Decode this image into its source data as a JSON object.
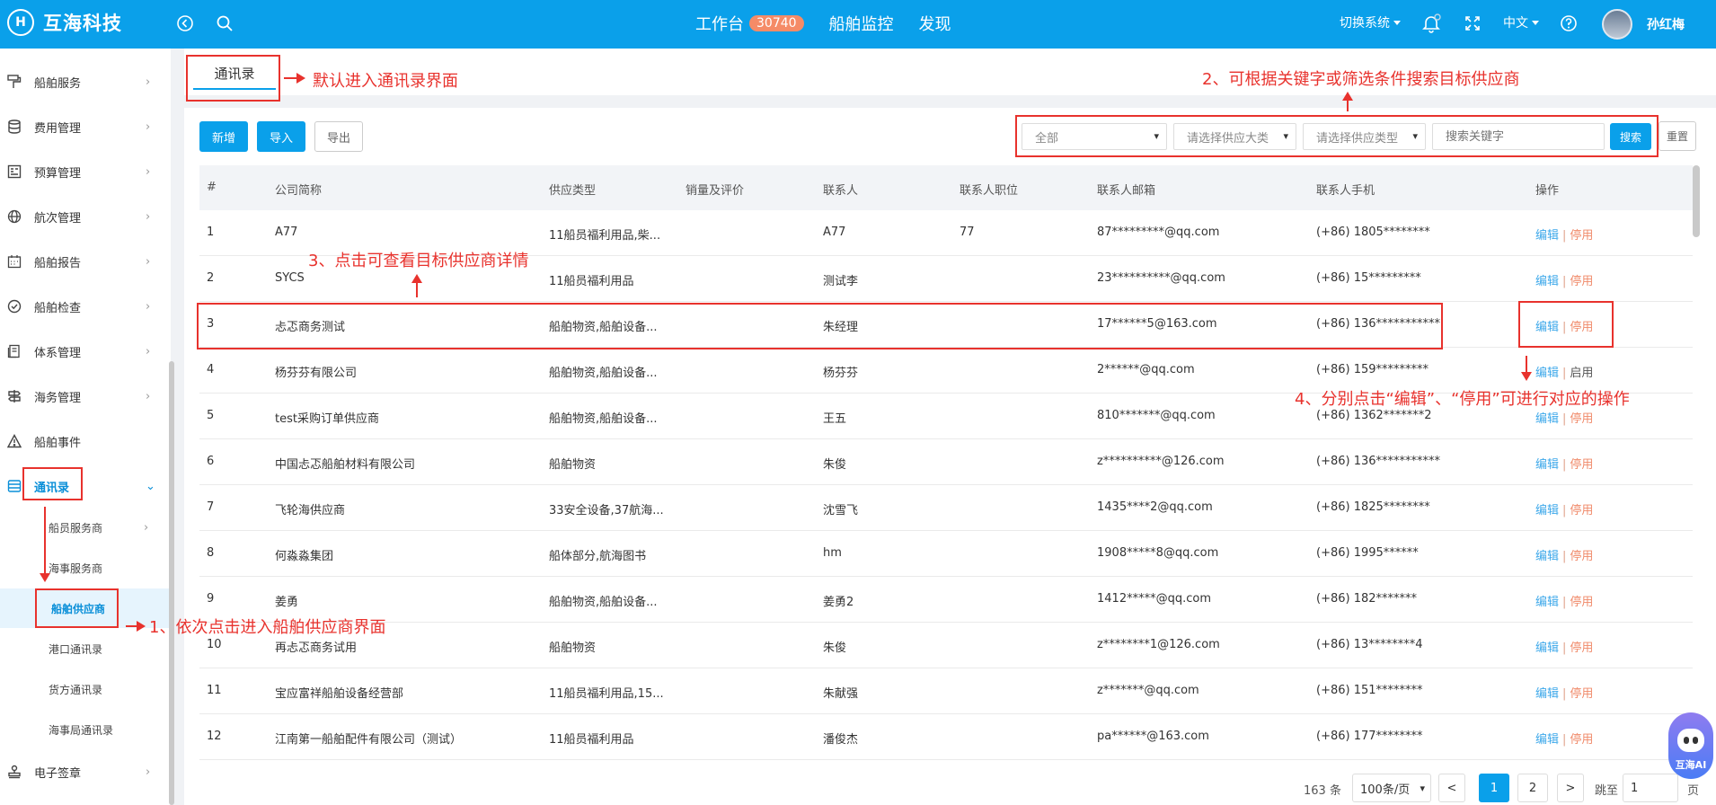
{
  "app": {
    "name": "互海科技",
    "logo_glyph": "H"
  },
  "topbar": {
    "nav": [
      {
        "label": "工作台",
        "badge": "30740"
      },
      {
        "label": "船舶监控"
      },
      {
        "label": "发现"
      }
    ],
    "switch_system": "切换系统",
    "language": "中文",
    "user": "孙红梅"
  },
  "sidebar": {
    "items": [
      {
        "label": "船舶服务",
        "icon": "paint-roller-icon"
      },
      {
        "label": "费用管理",
        "icon": "database-icon"
      },
      {
        "label": "预算管理",
        "icon": "budget-icon"
      },
      {
        "label": "航次管理",
        "icon": "globe-icon"
      },
      {
        "label": "船舶报告",
        "icon": "calendar-icon"
      },
      {
        "label": "船舶检查",
        "icon": "check-circle-icon"
      },
      {
        "label": "体系管理",
        "icon": "document-icon"
      },
      {
        "label": "海务管理",
        "icon": "signpost-icon"
      },
      {
        "label": "船舶事件",
        "icon": "warning-icon"
      },
      {
        "label": "通讯录",
        "icon": "contacts-icon"
      }
    ],
    "sub_items": [
      "船员服务商",
      "海事服务商",
      "船舶供应商",
      "港口通讯录",
      "货方通讯录",
      "海事局通讯录"
    ],
    "last_item": {
      "label": "电子签章",
      "icon": "stamp-icon"
    }
  },
  "tab": {
    "label": "通讯录"
  },
  "toolbar": {
    "add": "新增",
    "import": "导入",
    "export": "导出"
  },
  "filters": {
    "scope": "全部",
    "category_placeholder": "请选择供应大类",
    "type_placeholder": "请选择供应类型",
    "keyword_placeholder": "搜索关键字",
    "search": "搜索",
    "reset": "重置"
  },
  "table": {
    "headers": [
      "#",
      "公司简称",
      "供应类型",
      "销量及评价",
      "联系人",
      "联系人职位",
      "联系人邮箱",
      "联系人手机",
      "操作"
    ],
    "rows": [
      {
        "no": "1",
        "company": "A77",
        "supply": "11船员福利用品,柴...",
        "contact": "A77",
        "position": "77",
        "email": "87*********@qq.com",
        "phone": "(+86) 1805********",
        "status_action": "停用"
      },
      {
        "no": "2",
        "company": "SYCS",
        "supply": "11船员福利用品",
        "contact": "测试李",
        "position": "",
        "email": "23**********@qq.com",
        "phone": "(+86) 15*********",
        "status_action": "停用"
      },
      {
        "no": "3",
        "company": "忐忑商务测试",
        "supply": "船舶物资,船舶设备...",
        "contact": "朱经理",
        "position": "",
        "email": "17******5@163.com",
        "phone": "(+86) 136***********",
        "status_action": "停用"
      },
      {
        "no": "4",
        "company": "杨芬芬有限公司",
        "supply": "船舶物资,船舶设备...",
        "contact": "杨芬芬",
        "position": "",
        "email": "2******@qq.com",
        "phone": "(+86) 159*********",
        "status_action": "启用"
      },
      {
        "no": "5",
        "company": "test采购订单供应商",
        "supply": "船舶物资,船舶设备...",
        "contact": "王五",
        "position": "",
        "email": "810*******@qq.com",
        "phone": "(+86) 1362*******2",
        "status_action": "停用"
      },
      {
        "no": "6",
        "company": "中国忐忑船舶材料有限公司",
        "supply": "船舶物资",
        "contact": "朱俊",
        "position": "",
        "email": "z**********@126.com",
        "phone": "(+86) 136***********",
        "status_action": "停用"
      },
      {
        "no": "7",
        "company": "飞轮海供应商",
        "supply": "33安全设备,37航海...",
        "contact": "沈雪飞",
        "position": "",
        "email": "1435****2@qq.com",
        "phone": "(+86) 1825********",
        "status_action": "停用"
      },
      {
        "no": "8",
        "company": "何淼淼集团",
        "supply": "船体部分,航海图书",
        "contact": "hm",
        "position": "",
        "email": "1908*****8@qq.com",
        "phone": "(+86) 1995******",
        "status_action": "停用"
      },
      {
        "no": "9",
        "company": "姜勇",
        "supply": "船舶物资,船舶设备...",
        "contact": "姜勇2",
        "position": "",
        "email": "1412*****@qq.com",
        "phone": "(+86) 182*******",
        "status_action": "停用"
      },
      {
        "no": "10",
        "company": "再忐忑商务试用",
        "supply": "船舶物资",
        "contact": "朱俊",
        "position": "",
        "email": "z********1@126.com",
        "phone": "(+86) 13********4",
        "status_action": "停用"
      },
      {
        "no": "11",
        "company": "宝应富祥船舶设备经营部",
        "supply": "11船员福利用品,15...",
        "contact": "朱献强",
        "position": "",
        "email": "z*******@qq.com",
        "phone": "(+86) 151********",
        "status_action": "停用"
      },
      {
        "no": "12",
        "company": "江南第一船舶配件有限公司（测试）",
        "supply": "11船员福利用品",
        "contact": "潘俊杰",
        "position": "",
        "email": "pa******@163.com",
        "phone": "(+86) 177********",
        "status_action": "停用"
      }
    ],
    "edit_label": "编辑",
    "sep": "|"
  },
  "pagination": {
    "total": "163 条",
    "page_size": "100条/页",
    "prev": "<",
    "pages": [
      "1",
      "2"
    ],
    "current": "1",
    "next": ">",
    "goto_label": "跳至",
    "goto_value": "1",
    "page_suffix": "页"
  },
  "annotations": {
    "a1": "1、依次点击进入船舶供应商界面",
    "a2": "2、可根据关键字或筛选条件搜索目标供应商",
    "a3": "3、点击可查看目标供应商详情",
    "a4": "4、分别点击“编辑”、“停用”可进行对应的操作",
    "a_default": "默认进入通讯录界面"
  },
  "ai_widget": {
    "label": "互海AI"
  },
  "colors": {
    "primary": "#0aa0ea",
    "annotation": "#e8322d",
    "stop": "#f08a6a",
    "badge": "#f58b67"
  }
}
